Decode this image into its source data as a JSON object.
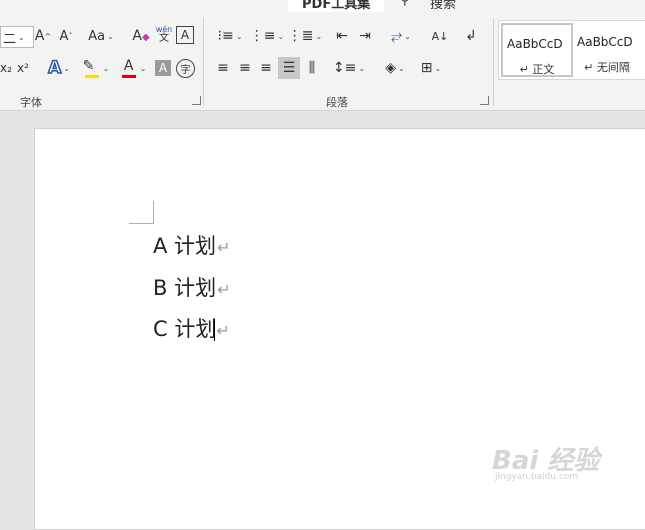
{
  "tabs": {
    "active_label": "PDF工具集",
    "search_label": "搜索"
  },
  "font_group": {
    "label": "字体",
    "font_size_value": "二",
    "grow_label": "A",
    "shrink_label": "A",
    "case_label": "Aa",
    "phonetic_top": "wén",
    "phonetic_bottom": "文",
    "border_char": "A",
    "subscript_label": "x₂",
    "superscript_label": "x²",
    "text_effect_label": "A",
    "font_color_label": "A",
    "shading_char": "A",
    "enclose_char": "字"
  },
  "paragraph_group": {
    "label": "段落"
  },
  "styles": [
    {
      "sample": "AaBbCcD",
      "name": "正文"
    },
    {
      "sample": "AaBbCcD",
      "name": "无间隔"
    }
  ],
  "document": {
    "paragraphs": [
      {
        "text": "A 计划"
      },
      {
        "text": "B 计划"
      },
      {
        "text": "C 计划"
      }
    ],
    "pilcrow": "↵"
  },
  "watermark": {
    "logo": "Bai 经验",
    "url": "jingyan.baidu.com"
  },
  "colors": {
    "highlight": "#f5e100",
    "font_color": "#e00000",
    "text_effect": "#2b579a"
  }
}
